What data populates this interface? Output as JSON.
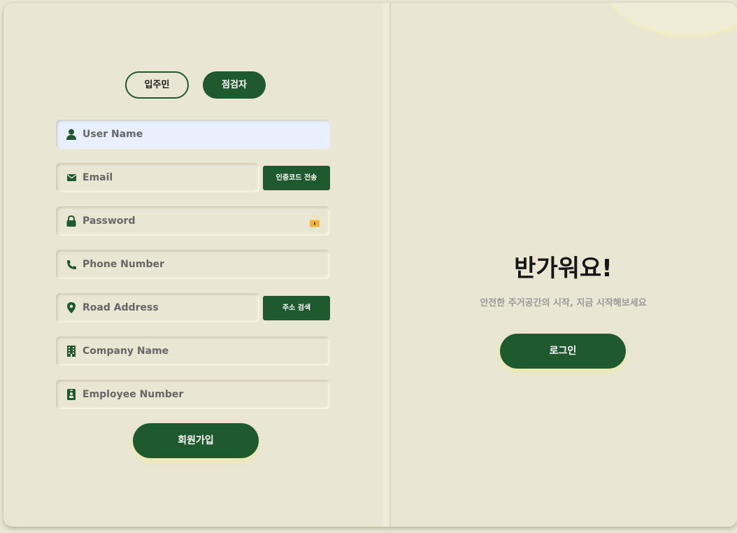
{
  "toggle": {
    "resident_label": "입주민",
    "inspector_label": "점검자"
  },
  "form": {
    "username_placeholder": "User Name",
    "email_placeholder": "Email",
    "send_code_label": "인증코드 전송",
    "password_placeholder": "Password",
    "phone_placeholder": "Phone Number",
    "address_placeholder": "Road Address",
    "address_search_label": "주소 검색",
    "company_placeholder": "Company Name",
    "employee_placeholder": "Employee Number",
    "signup_label": "회원가입"
  },
  "panel": {
    "welcome_title": "반가워요!",
    "subtitle": "안전한 주거공간의 시작, 지금 시작해보세요",
    "login_label": "로그인"
  },
  "colors": {
    "accent": "#1e5a2e",
    "background": "#e9e6d4",
    "lock_icon": "#f2b632"
  },
  "icons": {
    "username": "user-icon",
    "email": "envelope-icon",
    "password": "lock-icon",
    "password_toggle": "unlock-icon",
    "phone": "phone-icon",
    "address": "map-pin-icon",
    "company": "building-icon",
    "employee": "id-badge-icon"
  }
}
